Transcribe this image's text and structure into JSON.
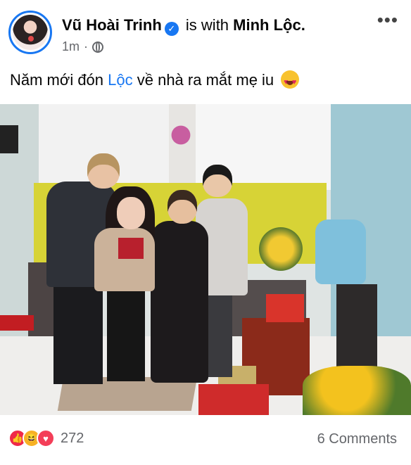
{
  "post": {
    "author": "Vũ Hoài Trinh",
    "with_text": "is with",
    "with_name": "Minh Lộc.",
    "time": "1m",
    "separator": "·",
    "caption_prefix": "Năm mới đón ",
    "caption_mention": "Lộc",
    "caption_suffix": " về nhà ra mắt mẹ iu",
    "more_label": "•••",
    "verified_glyph": "✓"
  },
  "footer": {
    "reaction_count": "272",
    "comments": "6 Comments"
  },
  "icons": {
    "more": "more-options-icon",
    "verified": "verified-badge-icon",
    "privacy": "globe-icon",
    "reactions": [
      "like-reaction-icon",
      "haha-reaction-icon",
      "love-reaction-icon"
    ]
  },
  "colors": {
    "accent": "#1877f2",
    "secondary_text": "#65676b"
  }
}
